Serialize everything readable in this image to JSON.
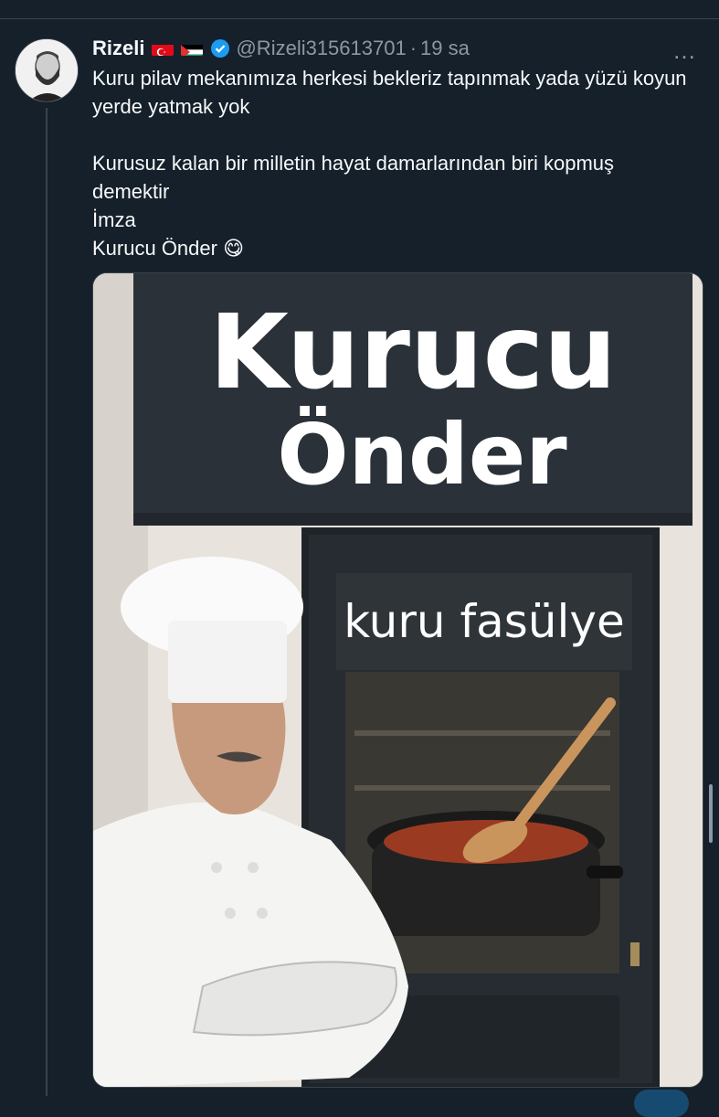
{
  "tweet": {
    "author_name": "Rizeli",
    "handle": "@Rizeli315613701",
    "separator": "·",
    "time": "19 sa",
    "more_icon": "…",
    "lines": [
      "Kuru pilav mekanımıza herkesi bekleriz tapınmak yada yüzü koyun yerde yatmak yok",
      "Kurusuz kalan bir milletin hayat damarlarından biri kopmuş demektir",
      "İmza",
      "Kurucu Önder 😋"
    ]
  },
  "media": {
    "sign_line1": "Kurucu",
    "sign_line2": "Önder",
    "sub_sign": "kuru fasülye"
  },
  "icons": [
    "avatar",
    "turkey-flag-icon",
    "palestine-flag-icon",
    "verified-badge-icon",
    "more-options-icon"
  ],
  "colors": {
    "background": "#15202b",
    "text": "#f7f9f9",
    "muted": "#8b98a5",
    "accent": "#1d9bf0"
  }
}
